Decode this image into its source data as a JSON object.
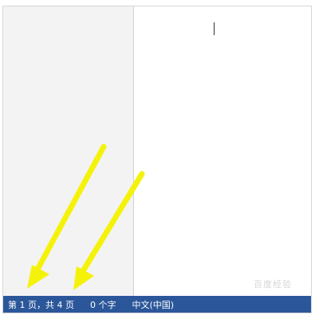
{
  "status_bar": {
    "page_info": "第 1 页，共 4 页",
    "word_count": "0 个字",
    "language": "中文(中国)"
  },
  "watermark": "百度经验",
  "annotations": {
    "arrow_color": "#f5f20a",
    "arrow_count": 2
  },
  "colors": {
    "status_bar": "#2b579a",
    "nav_pane": "#f3f3f3"
  }
}
